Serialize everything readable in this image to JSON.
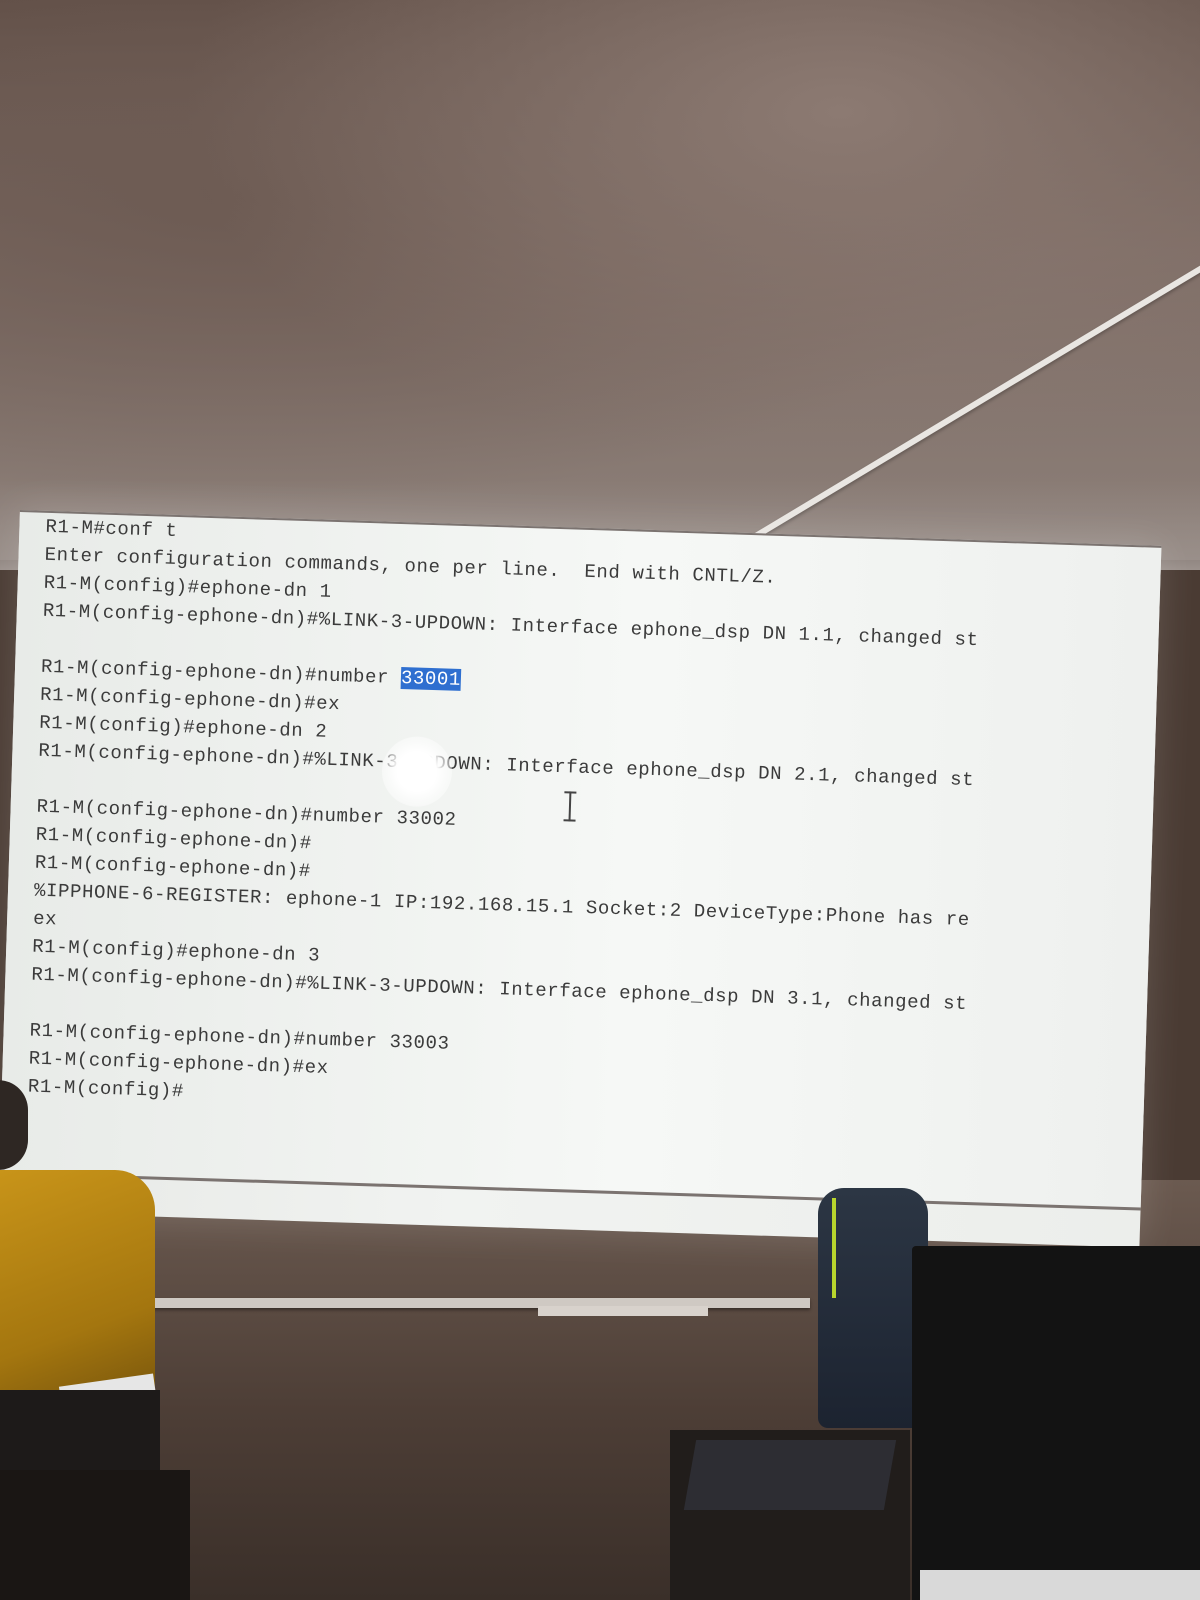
{
  "terminal": {
    "lines": [
      "R1-M#conf t",
      "Enter configuration commands, one per line.  End with CNTL/Z.",
      "R1-M(config)#ephone-dn 1",
      "R1-M(config-ephone-dn)#%LINK-3-UPDOWN: Interface ephone_dsp DN 1.1, changed st",
      "",
      "R1-M(config-ephone-dn)#number ",
      "R1-M(config-ephone-dn)#ex",
      "R1-M(config)#ephone-dn 2",
      "R1-M(config-ephone-dn)#%LINK-3-UPDOWN: Interface ephone_dsp DN 2.1, changed st",
      "",
      "R1-M(config-ephone-dn)#number 33002",
      "R1-M(config-ephone-dn)#",
      "R1-M(config-ephone-dn)#",
      "%IPPHONE-6-REGISTER: ephone-1 IP:192.168.15.1 Socket:2 DeviceType:Phone has re",
      "ex",
      "R1-M(config)#ephone-dn 3",
      "R1-M(config-ephone-dn)#%LINK-3-UPDOWN: Interface ephone_dsp DN 3.1, changed st",
      "",
      "R1-M(config-ephone-dn)#number 33003",
      "R1-M(config-ephone-dn)#ex",
      "R1-M(config)#"
    ],
    "selected_text": "33001"
  },
  "colors": {
    "selection": "#2f6fd0",
    "terminal_text": "#3b3b3b",
    "terminal_bg": "#f1f3f1"
  }
}
